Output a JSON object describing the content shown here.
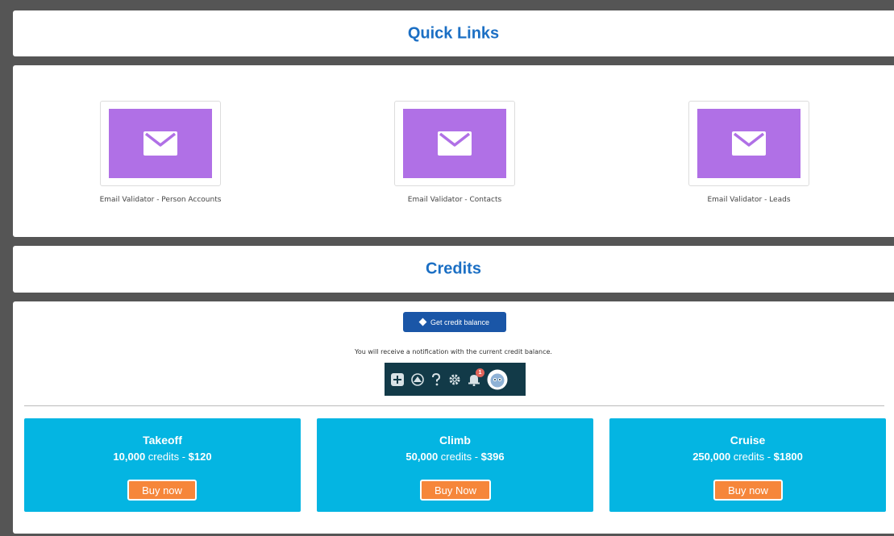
{
  "quick_links": {
    "title": "Quick Links",
    "items": [
      {
        "label": "Email Validator - Person Accounts",
        "icon": "envelope-icon"
      },
      {
        "label": "Email Validator - Contacts",
        "icon": "envelope-icon"
      },
      {
        "label": "Email Validator - Leads",
        "icon": "envelope-icon"
      }
    ]
  },
  "credits": {
    "title": "Credits",
    "balance_button_label": "Get credit balance",
    "notice": "You will receive a notification with the current credit balance.",
    "toolbar": {
      "icons": [
        "add-icon",
        "trailhead-icon",
        "help-icon",
        "setup-gear-icon",
        "notification-bell-icon",
        "user-avatar"
      ],
      "notification_count": "1"
    },
    "plans": [
      {
        "name": "Takeoff",
        "credits": "10,000",
        "credits_suffix": " credits - ",
        "price": "$120",
        "button": "Buy now"
      },
      {
        "name": "Climb",
        "credits": "50,000",
        "credits_suffix": " credits - ",
        "price": "$396",
        "button": "Buy Now"
      },
      {
        "name": "Cruise",
        "credits": "250,000",
        "credits_suffix": " credits - ",
        "price": "$1800",
        "button": "Buy now"
      }
    ]
  },
  "colors": {
    "title_blue": "#1b6fc4",
    "tile_purple": "#b070e6",
    "plan_cyan": "#04b5e2",
    "buy_orange": "#f6863a",
    "button_navy": "#1a56a7",
    "toolbar_dark": "#123a48"
  }
}
